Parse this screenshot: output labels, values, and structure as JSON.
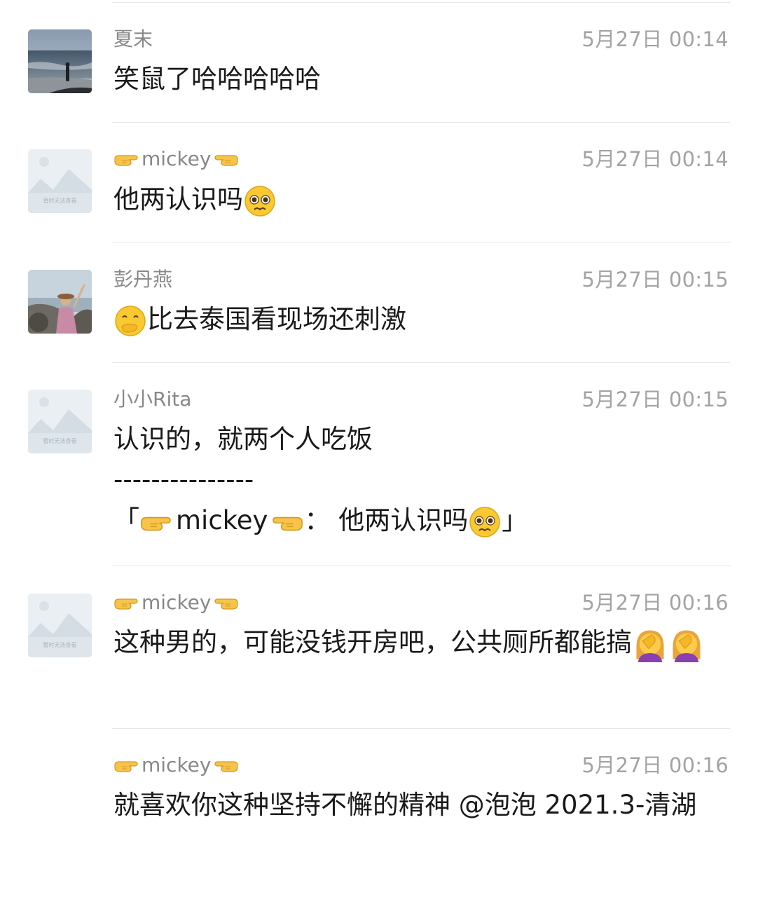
{
  "comments": [
    {
      "name": "夏末",
      "time": "5月27日 00:14",
      "text": "笑鼠了哈哈哈哈哈"
    },
    {
      "name": "mickey",
      "time": "5月27日 00:14",
      "text": "他两认识吗"
    },
    {
      "name": "彭丹燕",
      "time": "5月27日 00:15",
      "text": "比去泰国看现场还刺激"
    },
    {
      "name": "小小Rita",
      "time": "5月27日 00:15",
      "text": "认识的，就两个人吃饭",
      "separator": "---------------",
      "quote_open": "「",
      "quote_name": "mickey",
      "quote_colon": "：",
      "quote_text": "他两认识吗",
      "quote_close": "」"
    },
    {
      "name": "mickey",
      "time": "5月27日 00:16",
      "text": "这种男的，可能没钱开房吧，公共厕所都能搞"
    },
    {
      "name": "mickey",
      "time": "5月27日 00:16",
      "text": "就喜欢你这种坚持不懈的精神 @泡泡 2021.3-清湖"
    }
  ],
  "placeholder_avatar_text": "暂时无法查看",
  "colors": {
    "name": "#888888",
    "time": "#a3a3a3",
    "text": "#1a1a1a",
    "divider": "#e6e6e6"
  }
}
